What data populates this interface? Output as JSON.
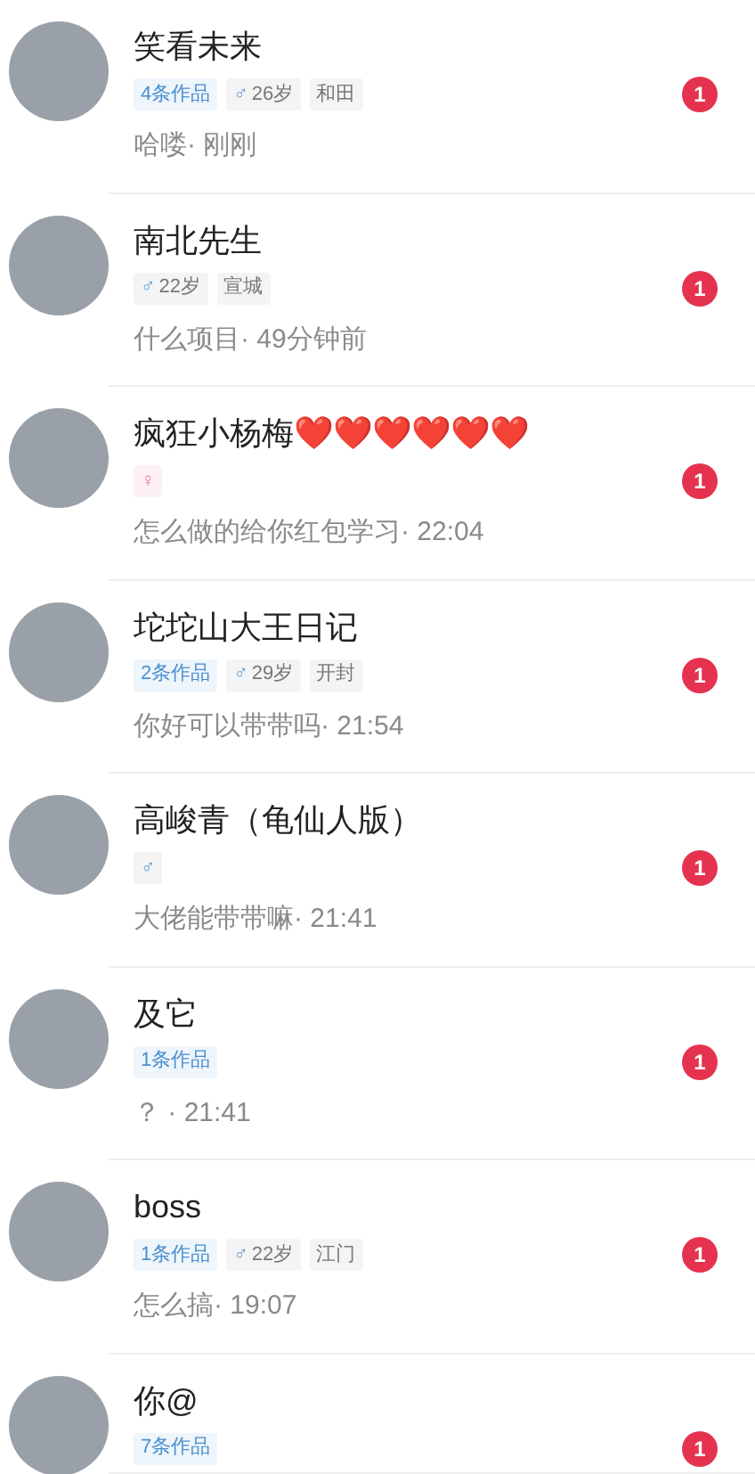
{
  "conversations": [
    {
      "name": "笑看未来",
      "tags": [
        {
          "kind": "works",
          "text": "4条作品"
        },
        {
          "kind": "gender",
          "symbol": "♂",
          "text": "26岁"
        },
        {
          "kind": "city",
          "text": "和田"
        }
      ],
      "message": "哈喽· 刚刚",
      "unread": "1"
    },
    {
      "name": "南北先生",
      "tags": [
        {
          "kind": "gender",
          "symbol": "♂",
          "text": "22岁"
        },
        {
          "kind": "city",
          "text": "宣城"
        }
      ],
      "message": "什么项目· 49分钟前",
      "unread": "1"
    },
    {
      "name": "疯狂小杨梅❤️❤️❤️❤️❤️❤️",
      "tags": [
        {
          "kind": "female",
          "symbol": "♀"
        }
      ],
      "message": "怎么做的给你红包学习· 22:04",
      "unread": "1"
    },
    {
      "name": "坨坨山大王日记",
      "tags": [
        {
          "kind": "works",
          "text": "2条作品"
        },
        {
          "kind": "gender",
          "symbol": "♂",
          "text": "29岁"
        },
        {
          "kind": "city",
          "text": "开封"
        }
      ],
      "message": "你好可以带带吗· 21:54",
      "unread": "1"
    },
    {
      "name": "高峻青（龟仙人版）",
      "tags": [
        {
          "kind": "gender",
          "symbol": "♂"
        }
      ],
      "message": "大佬能带带嘛· 21:41",
      "unread": "1"
    },
    {
      "name": "及它",
      "tags": [
        {
          "kind": "works",
          "text": "1条作品"
        }
      ],
      "message": "？ · 21:41",
      "unread": "1"
    },
    {
      "name": "boss",
      "tags": [
        {
          "kind": "works",
          "text": "1条作品"
        },
        {
          "kind": "gender",
          "symbol": "♂",
          "text": "22岁"
        },
        {
          "kind": "city",
          "text": "江门"
        }
      ],
      "message": "怎么搞· 19:07",
      "unread": "1"
    },
    {
      "name": "你@",
      "tags": [
        {
          "kind": "works",
          "text": "7条作品"
        }
      ],
      "unread": "1"
    }
  ]
}
